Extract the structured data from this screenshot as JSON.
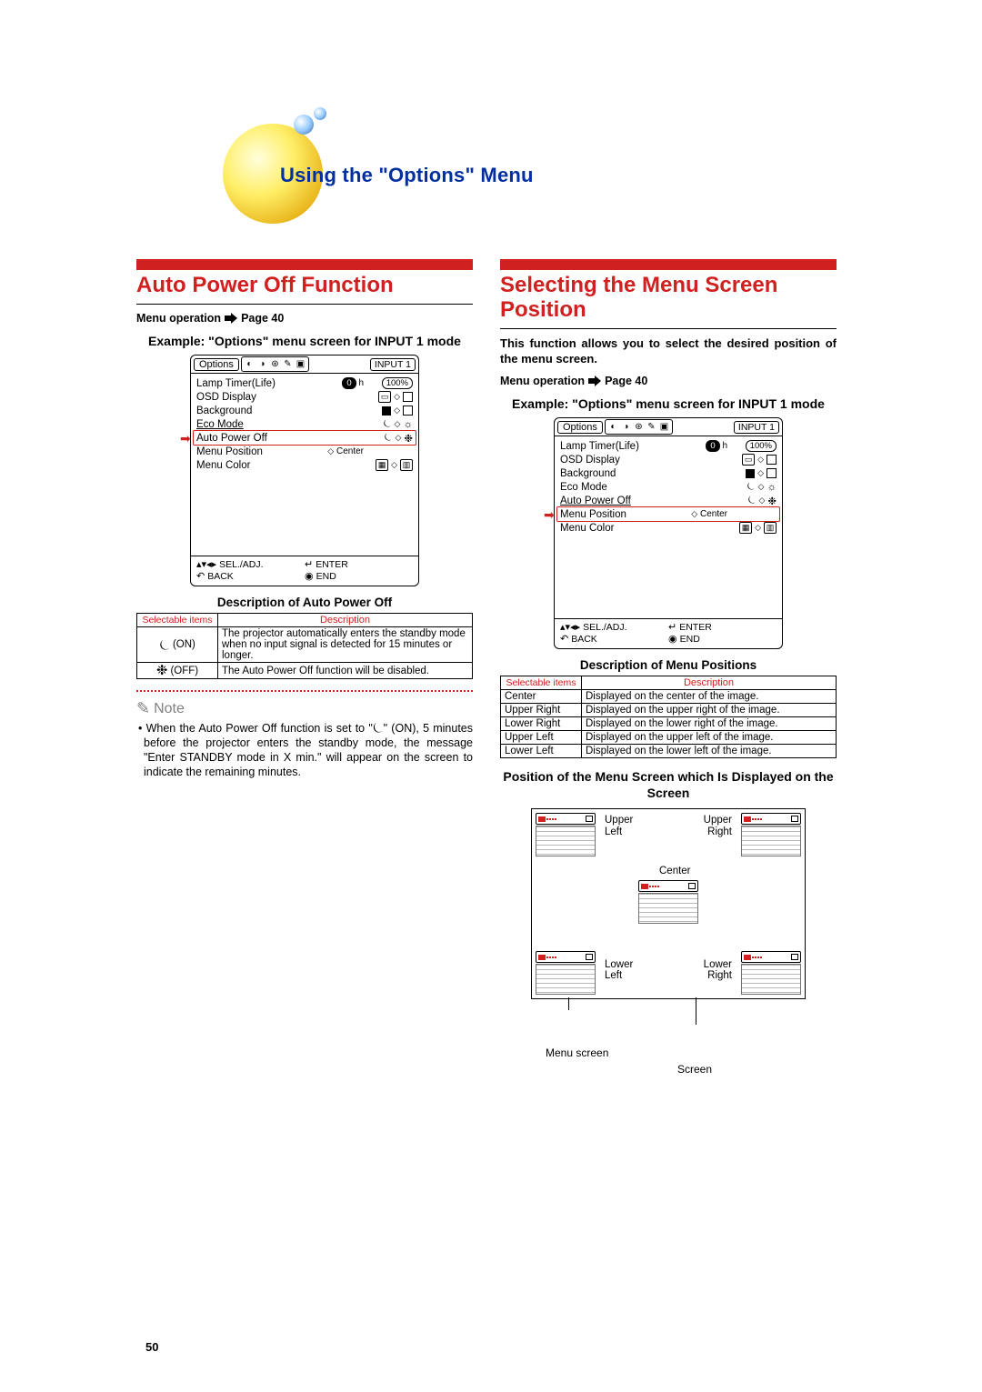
{
  "page": {
    "title": "Using the \"Options\" Menu",
    "number": "50"
  },
  "left": {
    "section_title": "Auto Power Off Function",
    "menu_op_label": "Menu operation",
    "menu_op_page": "Page 40",
    "example_head": "Example: \"Options\" menu screen for INPUT 1 mode",
    "desc_head": "Description of Auto Power Off",
    "table": {
      "col_items": "Selectable items",
      "col_desc": "Description",
      "rows": [
        {
          "item": "(ON)",
          "desc": "The projector automatically enters the standby mode when no input signal is detected for 15 minutes or longer."
        },
        {
          "item": "(OFF)",
          "desc": "The Auto Power Off function will be disabled."
        }
      ]
    },
    "note_label": "Note",
    "note_text_1": "• When the Auto Power Off function is set to \"",
    "note_text_2": "\" (ON), 5 minutes before the projector enters the standby mode, the message \"Enter STANDBY mode in X min.\" will appear on the screen to indicate the remaining minutes."
  },
  "right": {
    "section_title": "Selecting the Menu Screen Position",
    "lead": "This function allows you to select the desired position of the menu screen.",
    "menu_op_label": "Menu operation",
    "menu_op_page": "Page 40",
    "example_head": "Example: \"Options\" menu screen for INPUT 1 mode",
    "desc_head": "Description of Menu Positions",
    "table": {
      "col_items": "Selectable items",
      "col_desc": "Description",
      "rows": [
        {
          "item": "Center",
          "desc": "Displayed on the center of the image."
        },
        {
          "item": "Upper Right",
          "desc": "Displayed on the upper right of the image."
        },
        {
          "item": "Lower Right",
          "desc": "Displayed on the lower right of the image."
        },
        {
          "item": "Upper Left",
          "desc": "Displayed on the upper left of the image."
        },
        {
          "item": "Lower Left",
          "desc": "Displayed on the lower left of the image."
        }
      ]
    },
    "pos_head": "Position of the Menu Screen which Is Displayed on the Screen",
    "diagram": {
      "upper_left": "Upper Left",
      "upper_right": "Upper Right",
      "center": "Center",
      "lower_left": "Lower Left",
      "lower_right": "Lower Right",
      "menu_screen": "Menu screen",
      "screen": "Screen"
    }
  },
  "osd": {
    "tab": "Options",
    "input": "INPUT 1",
    "rows": {
      "lamp": "Lamp Timer(Life)",
      "lamp_h": "0",
      "lamp_unit": "h",
      "lamp_pct": "100%",
      "osd_display": "OSD Display",
      "background": "Background",
      "eco": "Eco Mode",
      "apo": "Auto Power Off",
      "menu_pos": "Menu Position",
      "menu_pos_val": "Center",
      "menu_color": "Menu Color"
    },
    "footer": {
      "sel": "SEL./ADJ.",
      "enter": "ENTER",
      "back": "BACK",
      "end": "END"
    }
  }
}
